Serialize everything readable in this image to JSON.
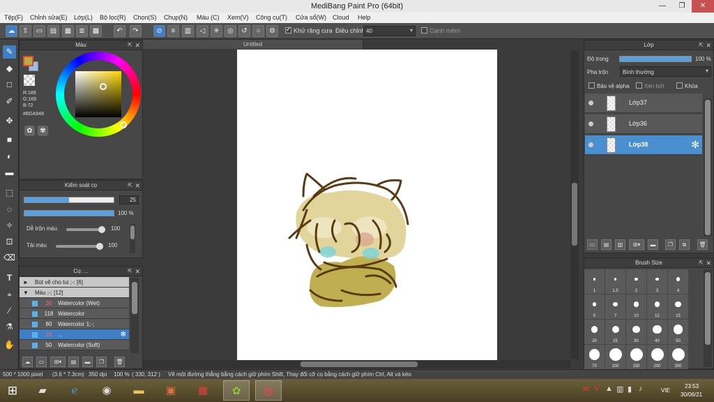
{
  "window": {
    "title": "MediBang Paint Pro (64bit)",
    "minimize_glyph": "—",
    "restore_glyph": "❐",
    "close_glyph": "✕"
  },
  "menu": [
    "Tệp(F)",
    "Chỉnh sửa(E)",
    "Lớp(L)",
    "Bộ lọc(R)",
    "Chọn(S)",
    "Chụp(N)",
    "Màu (C)",
    "Xem(V)",
    "Công cụ(T)",
    "Cửa sổ(W)",
    "Cloud",
    "Help"
  ],
  "toolbar": {
    "antialias_label": "Khử răng cưa",
    "adjust_label": "Điều chỉnh",
    "adjust_value": "40",
    "edge_label": "Cạnh mềm"
  },
  "color_panel": {
    "title": "Màu",
    "r": "R:189",
    "g": "G:169",
    "b": "B:72",
    "hex": "#BDA948",
    "primary_color": "#BDA948",
    "secondary_color": "#9ac0e8"
  },
  "brush_control": {
    "title": "Kiểm soát cọ",
    "size_value": "25",
    "size_fraction": 0.5,
    "opacity_value": "100 %",
    "opacity_fraction": 1.0,
    "blend_label": "Dễ trộn màu",
    "blend_value": "100",
    "blend_fraction": 1.0,
    "color_label": "Tải màu",
    "color_value": "100",
    "color_fraction": 1.0
  },
  "brush_panel": {
    "title": "Cọ: ...",
    "groups": [
      {
        "expander": "►",
        "label": "Bút vẽ cho tui ;-; [6]"
      },
      {
        "expander": "▼",
        "label": "Màu ;-; [12]"
      }
    ],
    "items": [
      {
        "size": "30",
        "name": "Watercolor (Wet)",
        "red": true,
        "selected": false
      },
      {
        "size": "118",
        "name": "Watercolor",
        "red": false,
        "selected": false
      },
      {
        "size": "80",
        "name": "Watercolor 1;-;",
        "red": false,
        "selected": false
      },
      {
        "size": "25",
        "name": "...",
        "red": true,
        "selected": true
      },
      {
        "size": "50",
        "name": "Watercolor (Soft)",
        "red": false,
        "selected": false
      }
    ]
  },
  "canvas": {
    "tab_title": "Untitled"
  },
  "layer_panel": {
    "title": "Lớp",
    "opacity_label": "Độ trong",
    "opacity_value": "100 %",
    "opacity_fraction": 1.0,
    "blend_label": "Pha trộn",
    "blend_value": "Bình thường",
    "protect_alpha": "Bảo vệ alpha",
    "clipping": "Xén bớt",
    "lock": "Khóa",
    "layers": [
      {
        "name": "Lớp37",
        "selected": false
      },
      {
        "name": "Lớp36",
        "selected": false
      },
      {
        "name": "Lớp38",
        "selected": true
      }
    ]
  },
  "brush_size_panel": {
    "title": "Brush Size",
    "sizes": [
      "1",
      "1.5",
      "2",
      "3",
      "4",
      "5",
      "7",
      "10",
      "12",
      "15",
      "20",
      "25",
      "30",
      "40",
      "50",
      "70",
      "100",
      "150",
      "200",
      "300"
    ]
  },
  "status": {
    "pixel_size": "500 * 1000 pixel",
    "cm_size": "(3.6 * 7.3cm)",
    "dpi": "350 dpi",
    "zoom": "100 %",
    "coords": "( 330, 312 )",
    "hint": "Vẽ một đường thẳng bằng cách giữ phím Shift, Thay đổi cỡ cọ bằng cách giữ phím Ctrl, Alt và kéo"
  },
  "taskbar": {
    "lang": "VIE",
    "time": "23:53",
    "date": "30/06/21"
  }
}
